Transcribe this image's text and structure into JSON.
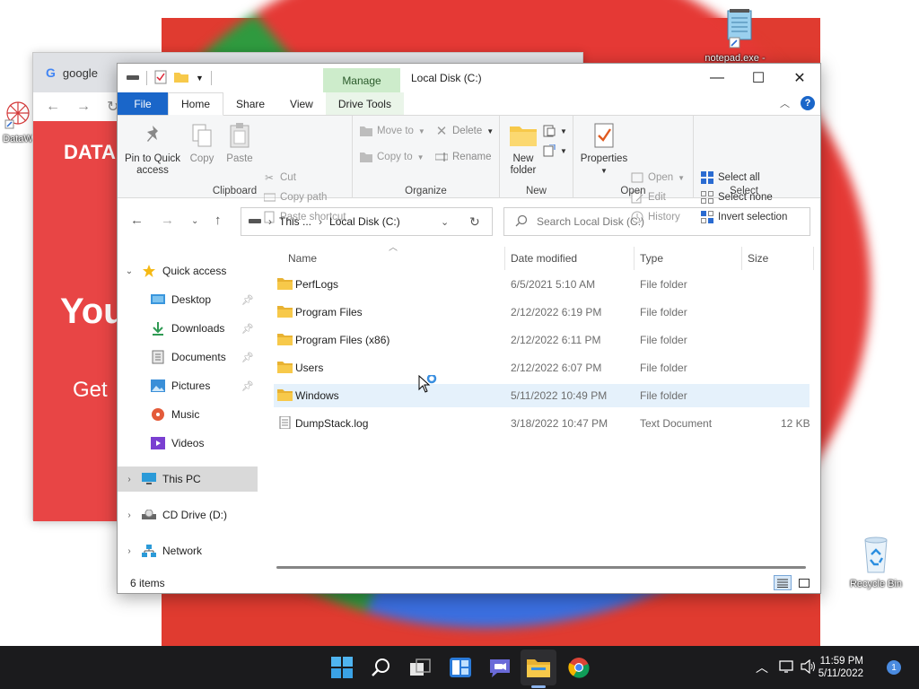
{
  "desktop": {
    "icons": [
      {
        "label": "DataW",
        "icon": "datawrapper-icon"
      },
      {
        "label": "notepad.exe -",
        "icon": "notepad-icon"
      },
      {
        "label": "Recycle Bin",
        "icon": "recycle-bin-icon"
      }
    ]
  },
  "chrome_window": {
    "tab_title": "google",
    "page_heading": "DATA",
    "page_text_big": "You",
    "page_text_small": "Get"
  },
  "explorer": {
    "title": "Local Disk (C:)",
    "manage_tab": "Manage",
    "tabs": [
      "File",
      "Home",
      "Share",
      "View",
      "Drive Tools"
    ],
    "ribbon": {
      "clipboard": {
        "label": "Clipboard",
        "pin": "Pin to Quick access",
        "copy": "Copy",
        "paste": "Paste",
        "cut": "Cut",
        "copy_path": "Copy path",
        "paste_shortcut": "Paste shortcut"
      },
      "organize": {
        "label": "Organize",
        "move_to": "Move to",
        "copy_to": "Copy to",
        "delete": "Delete",
        "rename": "Rename"
      },
      "new": {
        "label": "New",
        "new_folder": "New folder"
      },
      "open": {
        "label": "Open",
        "properties": "Properties",
        "open": "Open",
        "edit": "Edit",
        "history": "History"
      },
      "select": {
        "label": "Select",
        "select_all": "Select all",
        "select_none": "Select none",
        "invert": "Invert selection"
      }
    },
    "address": {
      "crumb1": "This ...",
      "crumb2": "Local Disk (C:)"
    },
    "search_placeholder": "Search Local Disk (C:)",
    "sidebar": {
      "quick_access": "Quick access",
      "items": [
        {
          "label": "Desktop",
          "icon": "desktop-icon",
          "pinned": true
        },
        {
          "label": "Downloads",
          "icon": "downloads-icon",
          "pinned": true
        },
        {
          "label": "Documents",
          "icon": "documents-icon",
          "pinned": true
        },
        {
          "label": "Pictures",
          "icon": "pictures-icon",
          "pinned": true
        },
        {
          "label": "Music",
          "icon": "music-icon",
          "pinned": false
        },
        {
          "label": "Videos",
          "icon": "videos-icon",
          "pinned": false
        }
      ],
      "this_pc": "This PC",
      "cd_drive": "CD Drive (D:)",
      "network": "Network"
    },
    "columns": [
      "Name",
      "Date modified",
      "Type",
      "Size"
    ],
    "files": [
      {
        "name": "PerfLogs",
        "date": "6/5/2021 5:10 AM",
        "type": "File folder",
        "size": "",
        "kind": "folder"
      },
      {
        "name": "Program Files",
        "date": "2/12/2022 6:19 PM",
        "type": "File folder",
        "size": "",
        "kind": "folder"
      },
      {
        "name": "Program Files (x86)",
        "date": "2/12/2022 6:11 PM",
        "type": "File folder",
        "size": "",
        "kind": "folder"
      },
      {
        "name": "Users",
        "date": "2/12/2022 6:07 PM",
        "type": "File folder",
        "size": "",
        "kind": "folder"
      },
      {
        "name": "Windows",
        "date": "5/11/2022 10:49 PM",
        "type": "File folder",
        "size": "",
        "kind": "folder"
      },
      {
        "name": "DumpStack.log",
        "date": "3/18/2022 10:47 PM",
        "type": "Text Document",
        "size": "12 KB",
        "kind": "file"
      }
    ],
    "status": "6 items"
  },
  "taskbar": {
    "time": "11:59 PM",
    "date": "5/11/2022",
    "notification_count": "1"
  },
  "colors": {
    "accent": "#1a66c9",
    "manage_tab": "#cdeccb",
    "selection": "#e5f1fb",
    "folder": "#f7c94a"
  }
}
